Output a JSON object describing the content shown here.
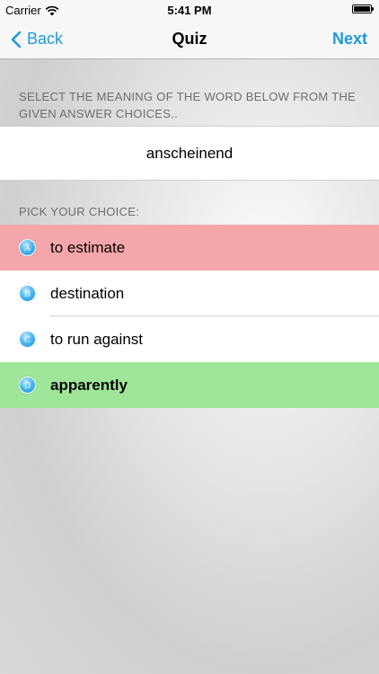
{
  "status_bar": {
    "carrier": "Carrier",
    "time": "5:41 PM"
  },
  "nav": {
    "back_label": "Back",
    "title": "Quiz",
    "next_label": "Next"
  },
  "instruction": "SELECT THE MEANING OF THE WORD BELOW FROM THE GIVEN ANSWER CHOICES..",
  "word": "anscheinend",
  "pick_label": "PICK YOUR CHOICE:",
  "choices": [
    {
      "letter": "A",
      "text": "to estimate",
      "state": "wrong"
    },
    {
      "letter": "B",
      "text": "destination",
      "state": "neutral"
    },
    {
      "letter": "C",
      "text": "to run against",
      "state": "neutral"
    },
    {
      "letter": "D",
      "text": "apparently",
      "state": "correct"
    }
  ],
  "colors": {
    "accent": "#1e9ad7",
    "wrong": "#f4a7aa",
    "correct": "#a0e69a"
  }
}
